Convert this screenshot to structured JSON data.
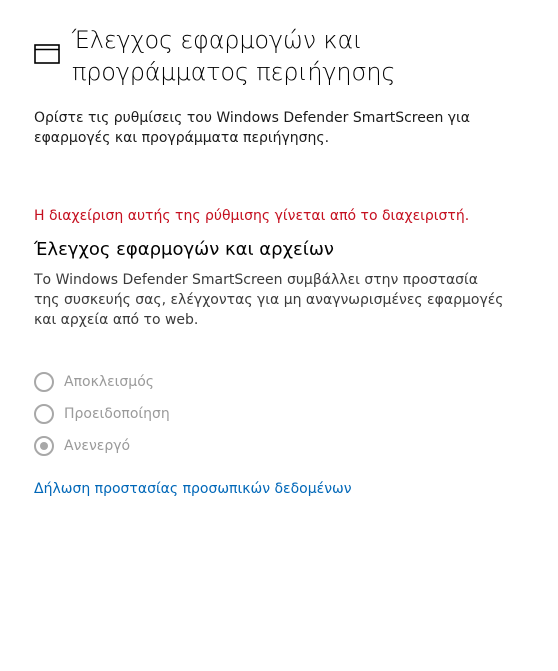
{
  "header": {
    "title": "Έλεγχος εφαρμογών και προγράμματος περιήγησης",
    "icon": "window-icon"
  },
  "description": "Ορίστε τις ρυθμίσεις του Windows Defender SmartScreen για εφαρμογές και προγράμματα περιήγησης.",
  "admin_warning": "Η διαχείριση αυτής της ρύθμισης γίνεται από το διαχειριστή.",
  "section": {
    "title": "Έλεγχος εφαρμογών και αρχείων",
    "description": "Το Windows Defender SmartScreen συμβάλλει στην προστασία της συσκευής σας, ελέγχοντας για μη αναγνωρισμένες εφαρμογές και αρχεία από το web.",
    "options": [
      {
        "label": "Αποκλεισμός",
        "selected": false,
        "disabled": true
      },
      {
        "label": "Προειδοποίηση",
        "selected": false,
        "disabled": true
      },
      {
        "label": "Ανενεργό",
        "selected": true,
        "disabled": true
      }
    ]
  },
  "privacy_link": "Δήλωση προστασίας προσωπικών δεδομένων",
  "colors": {
    "warning": "#c50f1f",
    "link": "#0067b8",
    "disabled": "#a8a8a8"
  }
}
